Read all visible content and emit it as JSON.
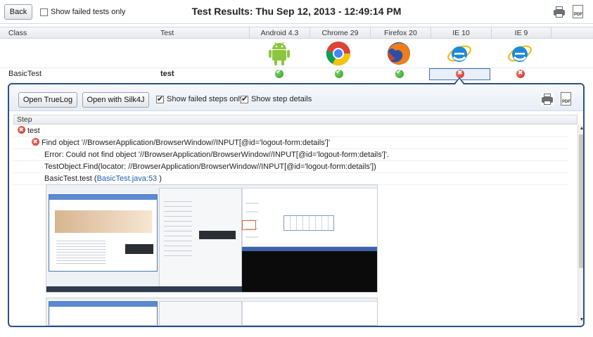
{
  "header": {
    "back_label": "Back",
    "show_failed_tests_label": "Show failed tests only",
    "title": "Test Results: Thu Sep 12, 2013 - 12:49:14 PM"
  },
  "table": {
    "col_class": "Class",
    "col_test": "Test",
    "browsers": [
      {
        "name": "Android 4.3",
        "icon": "android-icon",
        "status": "pass"
      },
      {
        "name": "Chrome 29",
        "icon": "chrome-icon",
        "status": "pass"
      },
      {
        "name": "Firefox 20",
        "icon": "firefox-icon",
        "status": "pass"
      },
      {
        "name": "IE 10",
        "icon": "ie-icon",
        "status": "fail",
        "selected": true
      },
      {
        "name": "IE 9",
        "icon": "ie-icon",
        "status": "fail"
      }
    ],
    "row": {
      "class": "BasicTest",
      "test": "test"
    }
  },
  "panel": {
    "open_truelog_label": "Open TrueLog",
    "open_silk4j_label": "Open with Silk4J",
    "show_failed_steps_label": "Show failed steps only",
    "show_step_details_label": "Show step details",
    "step_header": "Step",
    "steps": [
      {
        "text": "test",
        "type": "fail"
      },
      {
        "text": "Find object '//BrowserApplication/BrowserWindow//INPUT[@id='logout-form:details']'",
        "type": "fail"
      },
      {
        "text": "Error: Could not find object '//BrowserApplication/BrowserWindow//INPUT[@id='logout-form:details']'.",
        "type": "detail"
      },
      {
        "text": "TestObject.Find(locator: //BrowserApplication/BrowserWindow//INPUT[@id='logout-form:details'])",
        "type": "detail"
      },
      {
        "text_prefix": "BasicTest.test (",
        "link": "BasicTest.java:53",
        "text_suffix": " )",
        "type": "detail-link"
      }
    ]
  },
  "colors": {
    "panel_border": "#2c4f86",
    "pass": "#2f9a24",
    "fail": "#c9271c",
    "link": "#1f5fb5"
  }
}
